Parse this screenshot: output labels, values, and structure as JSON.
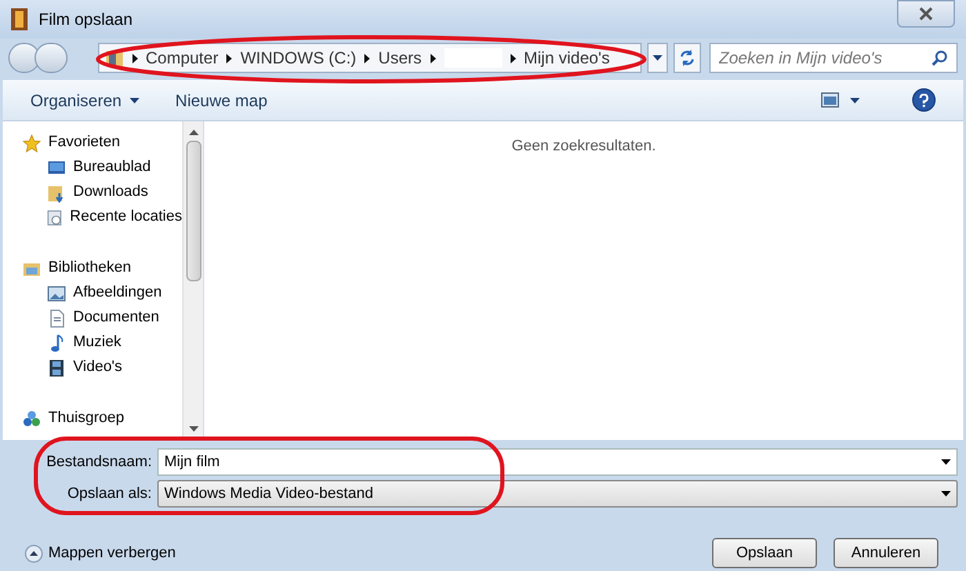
{
  "window": {
    "title": "Film opslaan"
  },
  "breadcrumb": [
    {
      "label": "Computer"
    },
    {
      "label": "WINDOWS (C:)"
    },
    {
      "label": "Users"
    },
    {
      "kind": "redacted"
    },
    {
      "label": "Mijn video's"
    }
  ],
  "search": {
    "placeholder": "Zoeken in Mijn video's"
  },
  "toolbar": {
    "organize": "Organiseren",
    "new_folder": "Nieuwe map"
  },
  "sidebar": {
    "items": [
      {
        "label": "Favorieten",
        "children": [
          {
            "label": "Bureaublad"
          },
          {
            "label": "Downloads"
          },
          {
            "label": "Recente locaties"
          }
        ]
      },
      {
        "label": "Bibliotheken",
        "children": [
          {
            "label": "Afbeeldingen"
          },
          {
            "label": "Documenten"
          },
          {
            "label": "Muziek"
          },
          {
            "label": "Video's"
          }
        ]
      },
      {
        "label": "Thuisgroep"
      }
    ]
  },
  "content": {
    "empty_message": "Geen zoekresultaten."
  },
  "form": {
    "filename_label": "Bestandsnaam:",
    "filename": "Mijn film",
    "type_label": "Opslaan als:",
    "type": "Windows Media Video-bestand"
  },
  "footer": {
    "toggle": "Mappen verbergen",
    "buttons": [
      "Opslaan",
      "Annuleren"
    ]
  }
}
